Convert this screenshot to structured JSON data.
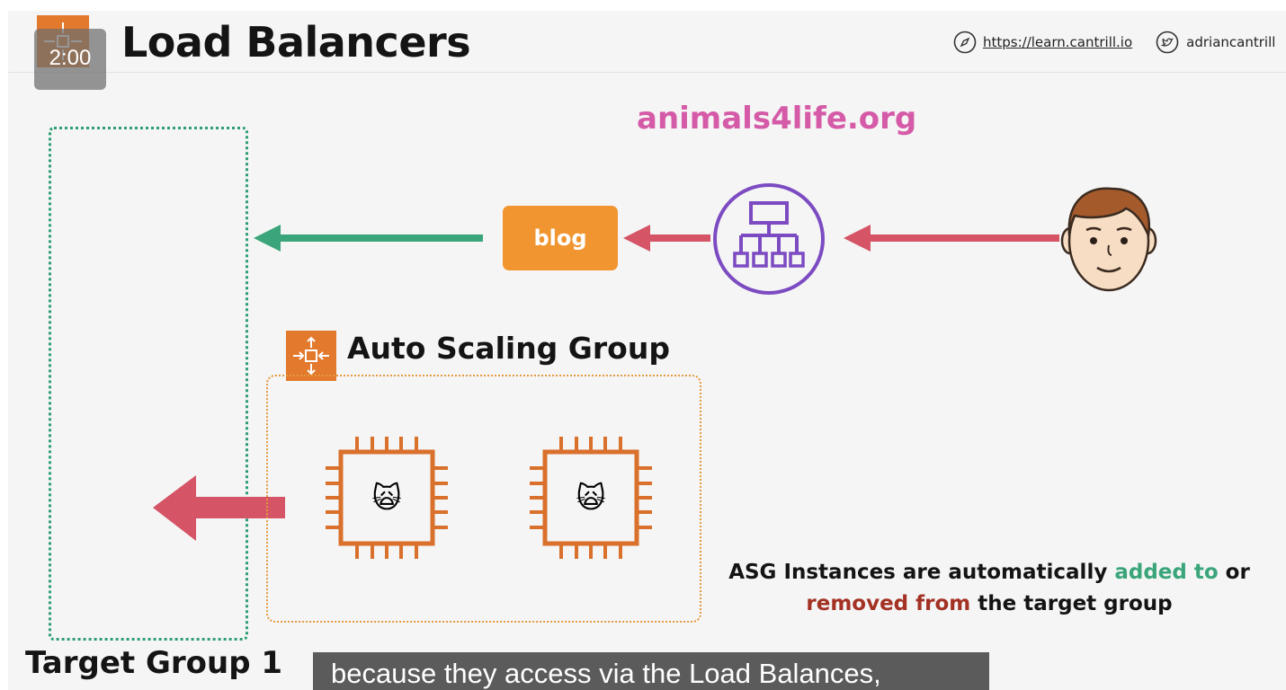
{
  "header": {
    "title": "Load Balancers",
    "timer": "2:00",
    "website": "https://learn.cantrill.io",
    "twitter_handle": "adriancantrill"
  },
  "diagram": {
    "site_label": "animals4life.org",
    "blog_label": "blog",
    "asg_title": "Auto Scaling Group",
    "target_group_label": "Target Group 1",
    "instance_emoji": "🙀",
    "note": {
      "part1": "ASG Instances are automatically ",
      "added": "added to",
      "part2": " or",
      "removed": "removed from",
      "part3": " the target group"
    }
  },
  "caption": {
    "text": "because they access via the Load Balances,"
  },
  "colors": {
    "orange": "#e2792c",
    "green": "#3aa57a",
    "pink_red": "#d55466",
    "purple": "#7c4bc2",
    "magenta": "#d55aa7"
  }
}
